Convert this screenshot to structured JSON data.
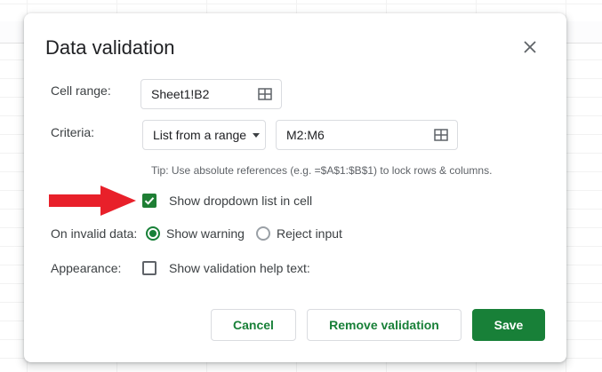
{
  "dialog": {
    "title": "Data validation",
    "close_icon": "close-icon"
  },
  "cell_range": {
    "label": "Cell range:",
    "value": "Sheet1!B2",
    "icon": "grid-select-icon"
  },
  "criteria": {
    "label": "Criteria:",
    "type_selected": "List from a range",
    "range_value": "M2:M6",
    "range_icon": "grid-select-icon",
    "tip": "Tip: Use absolute references (e.g. =$A$1:$B$1) to lock rows & columns."
  },
  "dropdown_option": {
    "label": "Show dropdown list in cell",
    "checked": true
  },
  "invalid_data": {
    "label": "On invalid data:",
    "options": [
      {
        "label": "Show warning",
        "selected": true
      },
      {
        "label": "Reject input",
        "selected": false
      }
    ]
  },
  "appearance": {
    "label": "Appearance:",
    "help_text_label": "Show validation help text:",
    "checked": false
  },
  "buttons": {
    "cancel": "Cancel",
    "remove": "Remove validation",
    "save": "Save"
  },
  "colors": {
    "accent": "#188038",
    "annotation_arrow": "#e8202a"
  }
}
